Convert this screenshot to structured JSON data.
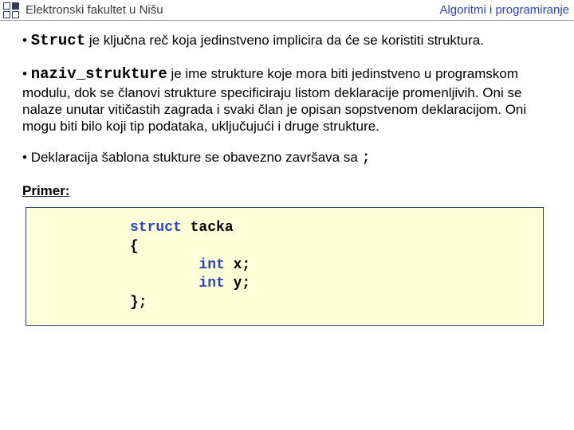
{
  "header": {
    "left": "Elektronski fakultet u Nišu",
    "right": "Algoritmi i programiranje"
  },
  "bullets": {
    "p1_keyword": "Struct",
    "p1_rest": " je ključna reč koja jedinstveno implicira da će se koristiti struktura.",
    "p2_keyword": "naziv_strukture",
    "p2_rest": " je ime strukture koje mora biti jedinstveno u programskom modulu, dok se članovi strukture specificiraju listom deklaracije promenljivih. Oni se nalaze unutar vitičastih zagrada i svaki član je opisan sopstvenom deklaracijom. Oni mogu biti bilo koji tip podataka, uključujući i druge strukture.",
    "p3_text": "Deklaracija šablona stukture se obavezno završava sa ",
    "p3_tail": ";"
  },
  "primer_label": "Primer:",
  "code": {
    "l1_kw": "struct",
    "l1_rest": " tacka",
    "l2": "{",
    "l3_indent": "        ",
    "l3_kw": "int",
    "l3_rest": " x;",
    "l4_indent": "        ",
    "l4_kw": "int",
    "l4_rest": " y;",
    "l5": "};"
  }
}
